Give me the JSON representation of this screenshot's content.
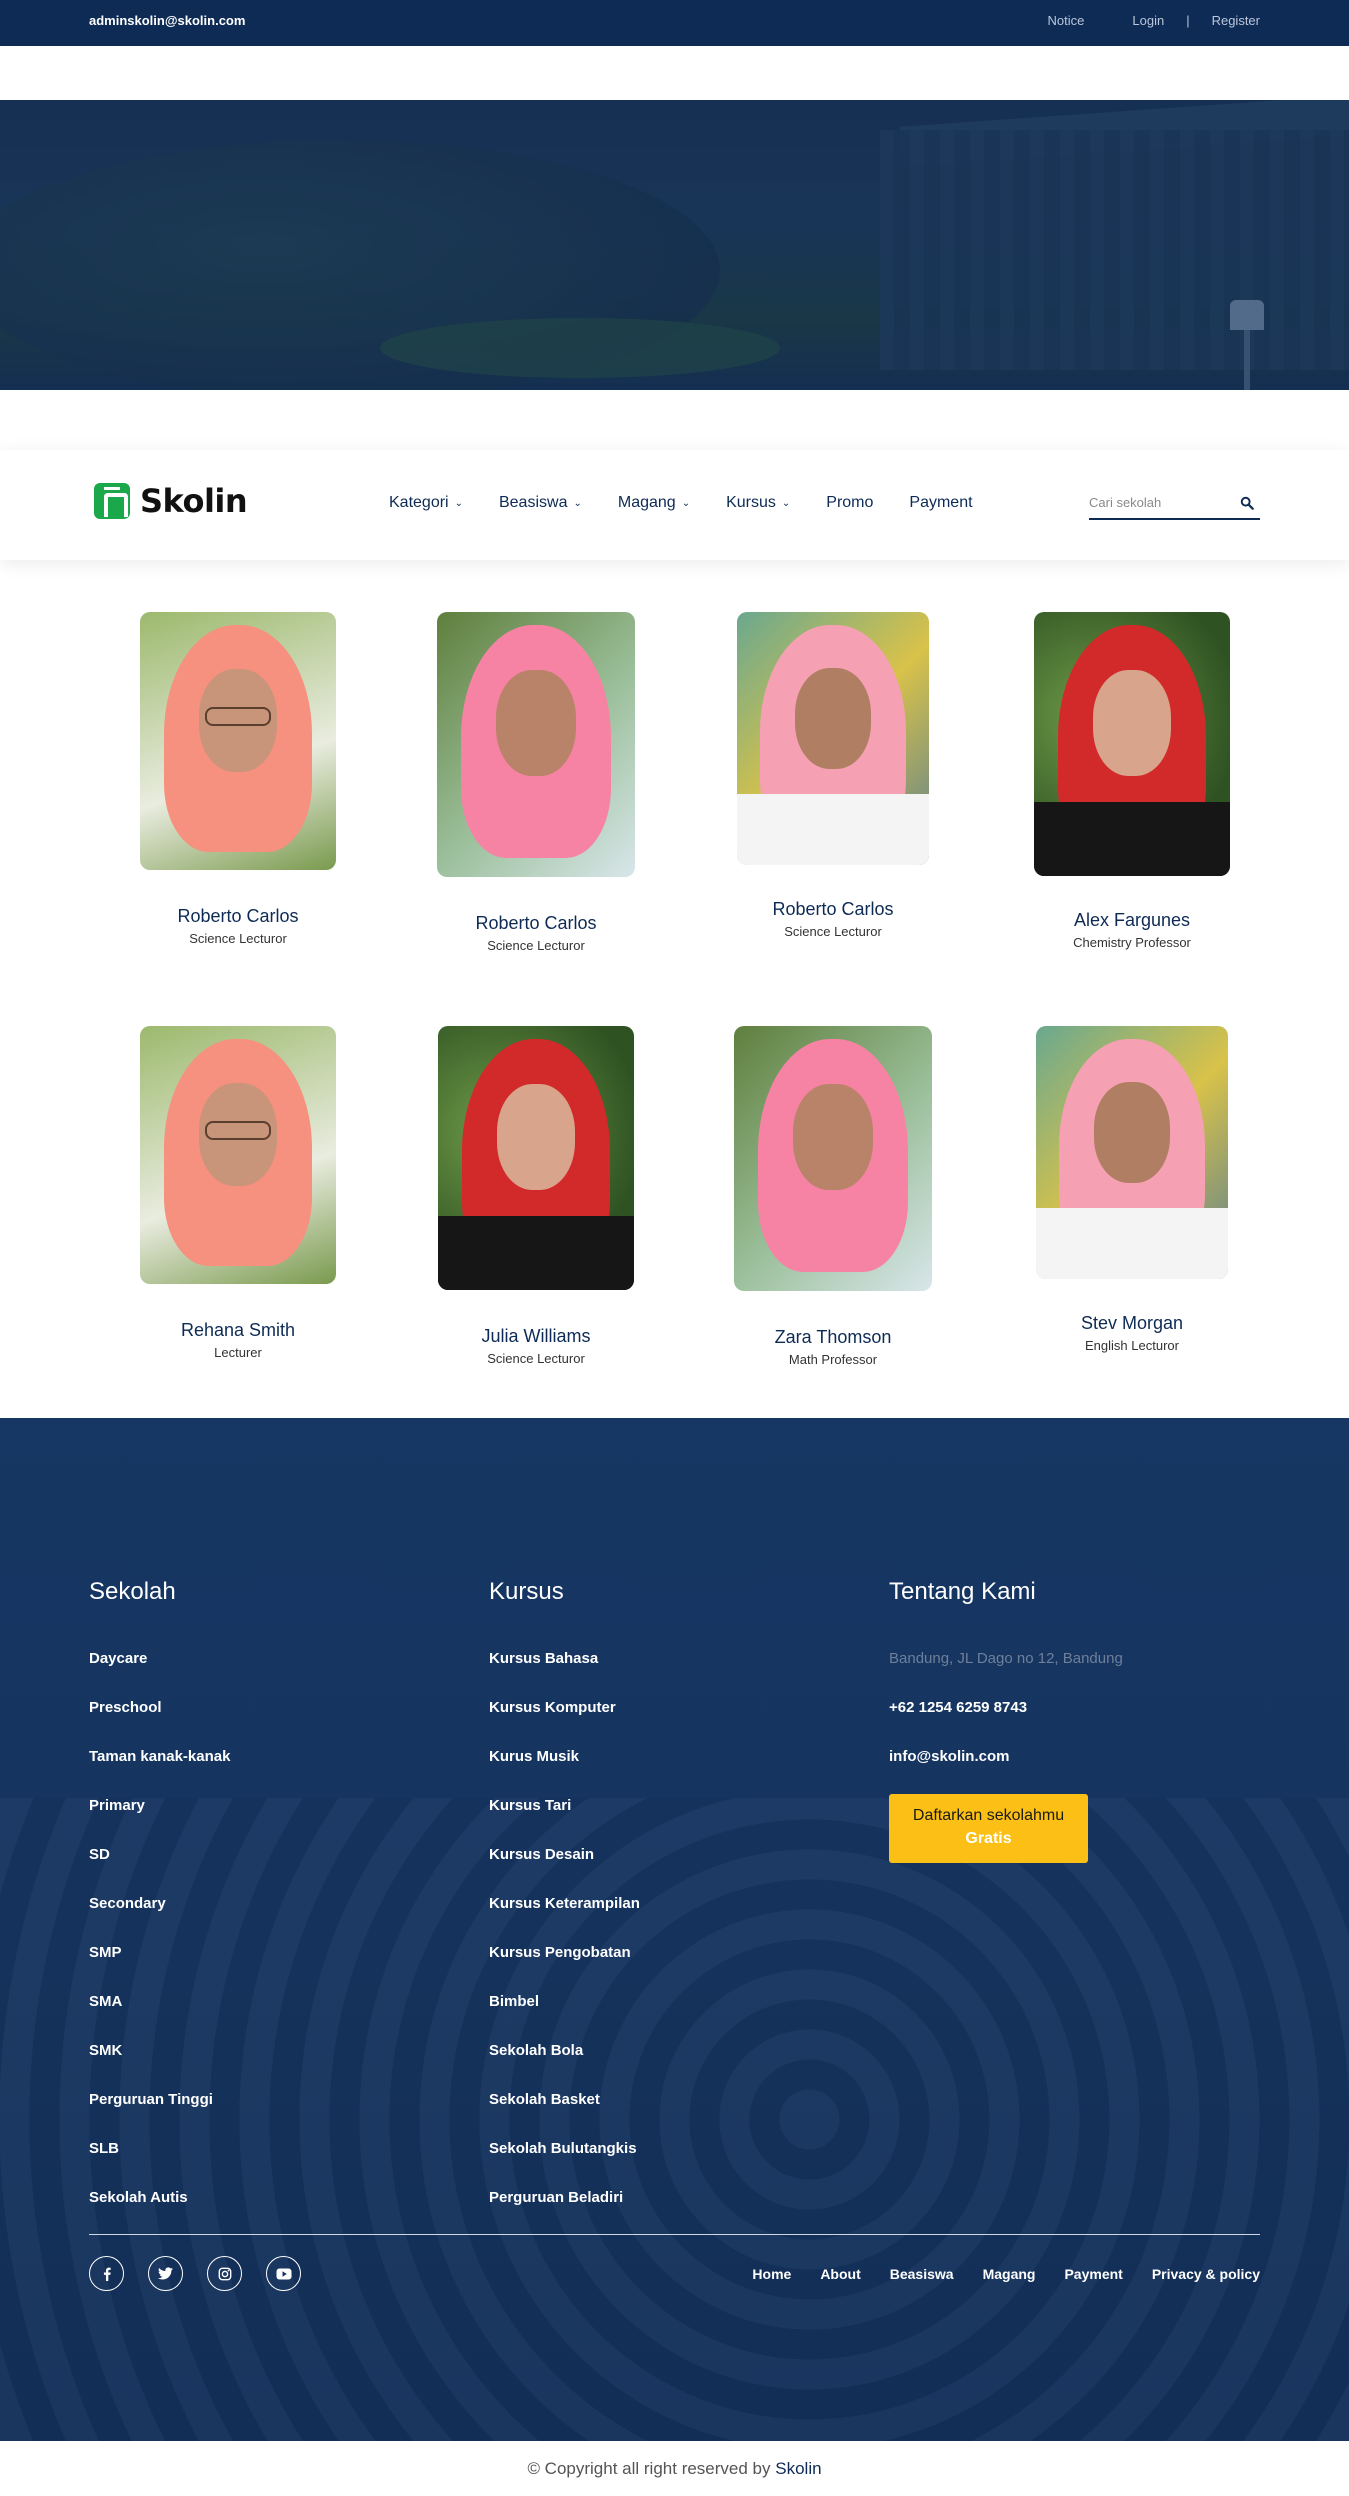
{
  "topbar": {
    "email": "adminskolin@skolin.com",
    "notice": "Notice",
    "login": "Login",
    "separator": "|",
    "register": "Register"
  },
  "brand": {
    "name": "Skolin",
    "logo_icon": "skolin-logo-icon",
    "brand_color": "#1aa84b"
  },
  "nav": {
    "items": [
      {
        "label": "Kategori",
        "dropdown": true
      },
      {
        "label": "Beasiswa",
        "dropdown": true
      },
      {
        "label": "Magang",
        "dropdown": true
      },
      {
        "label": "Kursus",
        "dropdown": true
      },
      {
        "label": "Promo",
        "dropdown": false
      },
      {
        "label": "Payment",
        "dropdown": false
      }
    ],
    "search_placeholder": "Cari sekolah",
    "search_icon": "search-icon"
  },
  "team": [
    {
      "name": "Roberto Carlos",
      "role": "Science Lecturor"
    },
    {
      "name": "Roberto Carlos",
      "role": "Science Lecturor"
    },
    {
      "name": "Roberto Carlos",
      "role": "Science Lecturor"
    },
    {
      "name": "Alex Fargunes",
      "role": "Chemistry Professor"
    },
    {
      "name": "Rehana Smith",
      "role": "Lecturer"
    },
    {
      "name": "Julia Williams",
      "role": "Science Lecturor"
    },
    {
      "name": "Zara Thomson",
      "role": "Math Professor"
    },
    {
      "name": "Stev Morgan",
      "role": "English Lecturor"
    }
  ],
  "footer": {
    "sekolah": {
      "title": "Sekolah",
      "items": [
        "Daycare",
        "Preschool",
        "Taman kanak-kanak",
        "Primary",
        "SD",
        "Secondary",
        "SMP",
        "SMA",
        "SMK",
        "Perguruan Tinggi",
        "SLB",
        "Sekolah Autis"
      ]
    },
    "kursus": {
      "title": "Kursus",
      "items": [
        "Kursus Bahasa",
        "Kursus Komputer",
        "Kurus Musik",
        "Kursus Tari",
        "Kursus Desain",
        "Kursus Keterampilan",
        "Kursus Pengobatan",
        "Bimbel",
        "Sekolah Bola",
        "Sekolah Basket",
        "Sekolah Bulutangkis",
        "Perguruan Beladiri"
      ]
    },
    "tentang": {
      "title": "Tentang Kami",
      "address": "Bandung, JL Dago no 12, Bandung",
      "phone": "+62 1254 6259 8743",
      "email": "info@skolin.com",
      "cta_line1": "Daftarkan sekolahmu",
      "cta_line2": "Gratis",
      "cta_color": "#fbbf16"
    },
    "socials": [
      "facebook-icon",
      "twitter-icon",
      "instagram-icon",
      "youtube-icon"
    ],
    "links": [
      "Home",
      "About",
      "Beasiswa",
      "Magang",
      "Payment",
      "Privacy & policy"
    ]
  },
  "copyright": {
    "text": "© Copyright all right reserved by",
    "brand": "Skolin"
  }
}
